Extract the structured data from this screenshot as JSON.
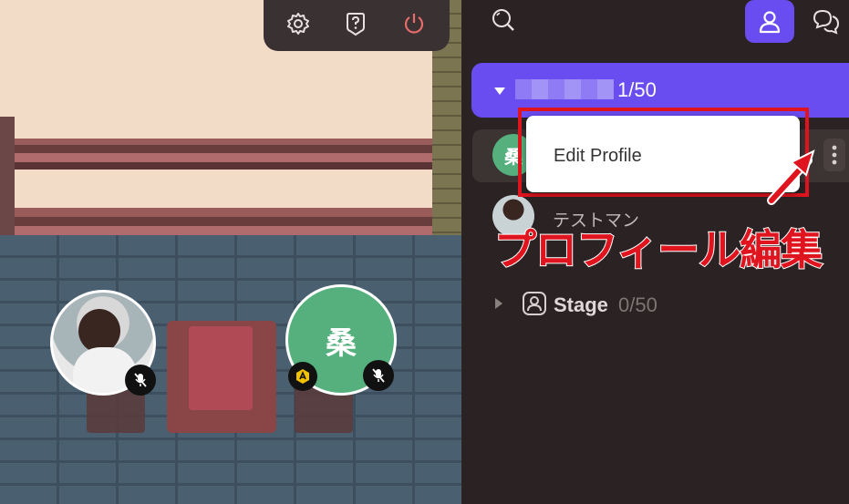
{
  "toolbar": {
    "settings_icon": "gear-icon",
    "help_icon": "question-shield-icon",
    "power_icon": "power-icon",
    "power_color": "#e86b6b"
  },
  "scene": {
    "player_initial": "桑"
  },
  "sidebar": {
    "search_icon": "search-icon",
    "people_icon": "person-icon",
    "chat_icon": "chat-bubbles-icon",
    "accent": "#6a4df0",
    "group": {
      "count": "1/50"
    },
    "members": [
      {
        "initial": "桑",
        "name": ""
      },
      {
        "name": "テストマン"
      }
    ],
    "stage": {
      "label": "Stage",
      "count": "0/50"
    }
  },
  "menu": {
    "edit_profile": "Edit Profile"
  },
  "annotation": {
    "text": "プロフィール編集"
  }
}
